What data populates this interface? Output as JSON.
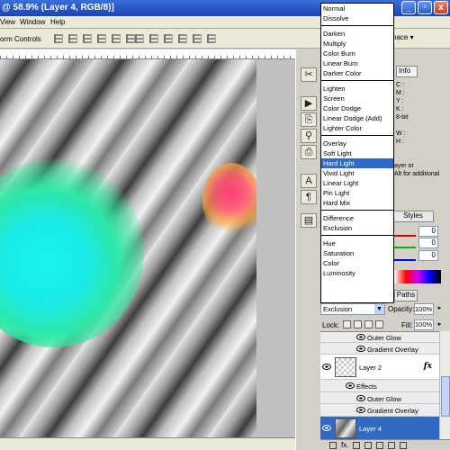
{
  "window": {
    "title": "@ 58.9% (Layer 4, RGB/8)]",
    "buttons": {
      "minimize": "_",
      "restore": "▫",
      "close": "x"
    }
  },
  "menu": {
    "items": [
      "View",
      "Window",
      "Help"
    ]
  },
  "options_bar": {
    "form_controls": "orm Controls",
    "workspace": "space ▾"
  },
  "info_panel": {
    "tab": "Info",
    "letters": [
      "C :",
      "M :",
      "Y :",
      "K :",
      "8-bit",
      "",
      "W :",
      "H :"
    ],
    "text": [
      "ayer or",
      "Alt for additional"
    ]
  },
  "styles_panel": {
    "tab": "Styles"
  },
  "color_panel": {
    "channels": [
      {
        "color": "#d40000",
        "value": "0"
      },
      {
        "color": "#00b400",
        "value": "0"
      },
      {
        "color": "#0000d4",
        "value": "0"
      }
    ]
  },
  "paths_panel": {
    "tab": "Paths"
  },
  "blend_modes": {
    "groups": [
      [
        "Normal",
        "Dissolve"
      ],
      [
        "Darken",
        "Multiply",
        "Color Burn",
        "Linear Burn",
        "Darker Color"
      ],
      [
        "Lighten",
        "Screen",
        "Color Dodge",
        "Linear Dodge (Add)",
        "Lighter Color"
      ],
      [
        "Overlay",
        "Soft Light",
        "Hard Light",
        "Vivid Light",
        "Linear Light",
        "Pin Light",
        "Hard Mix"
      ],
      [
        "Difference",
        "Exclusion"
      ],
      [
        "Hue",
        "Saturation",
        "Color",
        "Luminosity"
      ]
    ],
    "highlighted": "Hard Light"
  },
  "layers_panel": {
    "blend_value": "Exclusion",
    "opacity_label": "Opacity:",
    "opacity_value": "100%",
    "lock_label": "Lock:",
    "fill_label": "Fill:",
    "fill_value": "100%",
    "rows": {
      "outer_glow_1": "Outer Glow",
      "gradient_overlay_1": "Gradient Overlay",
      "layer2": "Layer 2",
      "effects": "Effects",
      "outer_glow_2": "Outer Glow",
      "gradient_overlay_2": "Gradient Overlay",
      "layer4": "Layer 4"
    },
    "fx": "fx"
  },
  "footer": {
    "fx": "fx."
  }
}
